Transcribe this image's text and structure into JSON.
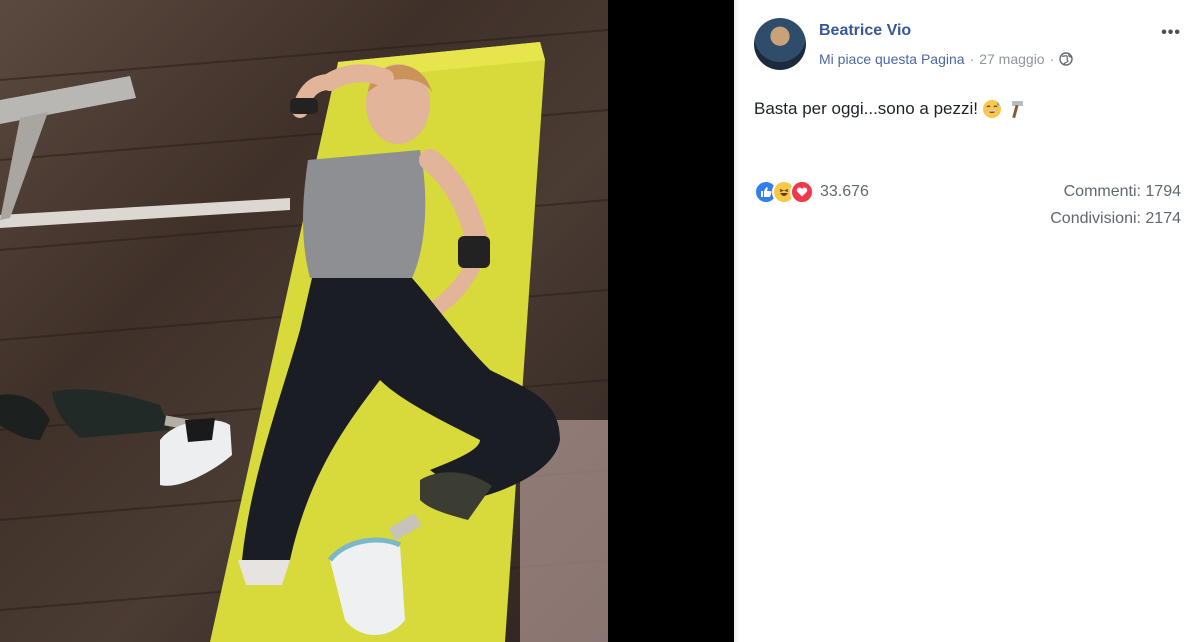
{
  "post": {
    "author": "Beatrice Vio",
    "meta_like": "Mi piace questa Pagina",
    "meta_sep1": "·",
    "date": "27 maggio",
    "meta_sep2": "·",
    "text": "Basta per oggi...sono a pezzi!",
    "more": "•••"
  },
  "stats": {
    "reactions_count": "33.676",
    "comments": "Commenti: 1794",
    "shares": "Condivisioni: 2174"
  },
  "icons": {
    "privacy": "globe-icon",
    "reactions": [
      "like-icon",
      "haha-icon",
      "love-icon"
    ],
    "emojis": [
      "grinning-sweat-emoji",
      "hammer-emoji"
    ]
  },
  "colors": {
    "author": "#365899",
    "mat": "#d8d93a",
    "floor": "#4a3b33"
  }
}
